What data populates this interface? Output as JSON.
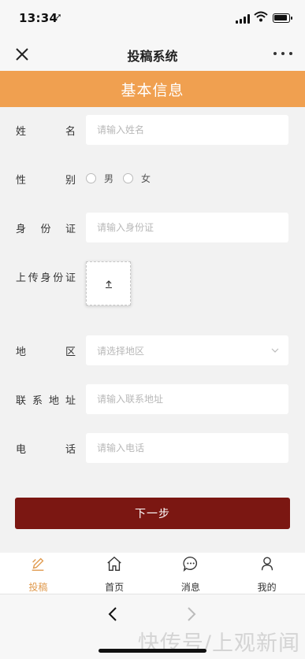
{
  "status": {
    "time": "13:34"
  },
  "nav": {
    "title": "投稿系统"
  },
  "banner": {
    "title": "基本信息"
  },
  "form": {
    "name": {
      "label": [
        "姓",
        "名"
      ],
      "placeholder": "请输入姓名"
    },
    "gender": {
      "label": [
        "性",
        "别"
      ],
      "options": [
        "男",
        "女"
      ]
    },
    "id_card": {
      "label": [
        "身",
        "份",
        "证"
      ],
      "placeholder": "请输入身份证"
    },
    "upload": {
      "label": [
        "上",
        "传",
        "身",
        "份",
        "证"
      ]
    },
    "region": {
      "label": [
        "地",
        "区"
      ],
      "placeholder": "请选择地区"
    },
    "address": {
      "label": [
        "联",
        "系",
        "地",
        "址"
      ],
      "placeholder": "请输入联系地址"
    },
    "phone": {
      "label": [
        "电",
        "话"
      ],
      "placeholder": "请输入电话"
    }
  },
  "next_button": "下一步",
  "tabs": [
    {
      "label": "投稿",
      "icon": "edit-icon",
      "active": true
    },
    {
      "label": "首页",
      "icon": "home-icon",
      "active": false
    },
    {
      "label": "消息",
      "icon": "message-icon",
      "active": false
    },
    {
      "label": "我的",
      "icon": "user-icon",
      "active": false
    }
  ],
  "watermark": "快传号/上观新闻",
  "colors": {
    "accent": "#f0a050",
    "primary": "#7b1712",
    "tab_active": "#e09a4e"
  }
}
